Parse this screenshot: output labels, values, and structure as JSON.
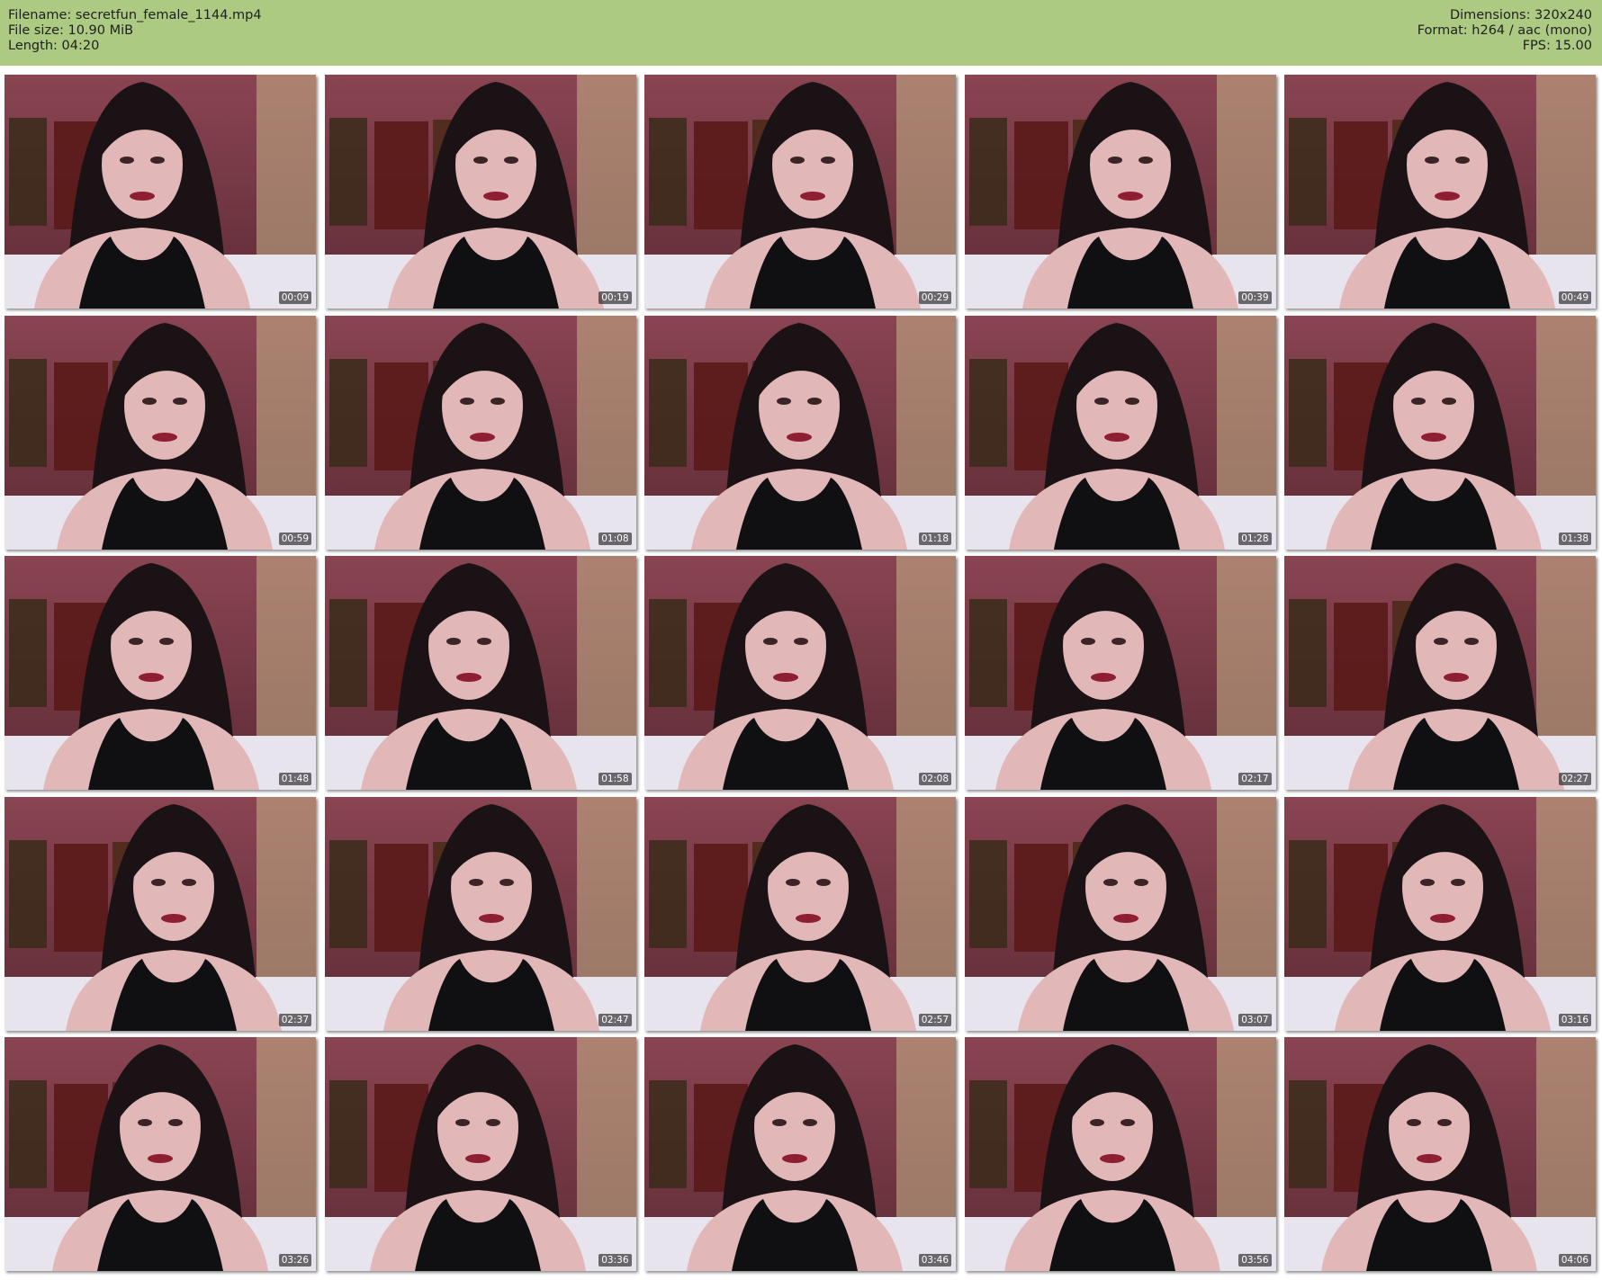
{
  "header": {
    "filename_line": "Filename: secretfun_female_1144.mp4",
    "filesize_line": "File size: 10.90 MiB",
    "length_line": "Length: 04:20",
    "dimensions_line": "Dimensions: 320x240",
    "format_line": "Format: h264 / aac (mono)",
    "fps_line": "FPS: 15.00"
  },
  "colors": {
    "header_bg": "#acca82",
    "wall": "#7a3a48",
    "hair": "#1a1214",
    "top": "#101012",
    "skin": "#e2b7b8"
  },
  "thumbnails": [
    {
      "time": "00:09"
    },
    {
      "time": "00:19"
    },
    {
      "time": "00:29"
    },
    {
      "time": "00:39"
    },
    {
      "time": "00:49"
    },
    {
      "time": "00:59"
    },
    {
      "time": "01:08"
    },
    {
      "time": "01:18"
    },
    {
      "time": "01:28"
    },
    {
      "time": "01:38"
    },
    {
      "time": "01:48"
    },
    {
      "time": "01:58"
    },
    {
      "time": "02:08"
    },
    {
      "time": "02:17"
    },
    {
      "time": "02:27"
    },
    {
      "time": "02:37"
    },
    {
      "time": "02:47"
    },
    {
      "time": "02:57"
    },
    {
      "time": "03:07"
    },
    {
      "time": "03:16"
    },
    {
      "time": "03:26"
    },
    {
      "time": "03:36"
    },
    {
      "time": "03:46"
    },
    {
      "time": "03:56"
    },
    {
      "time": "04:06"
    }
  ]
}
